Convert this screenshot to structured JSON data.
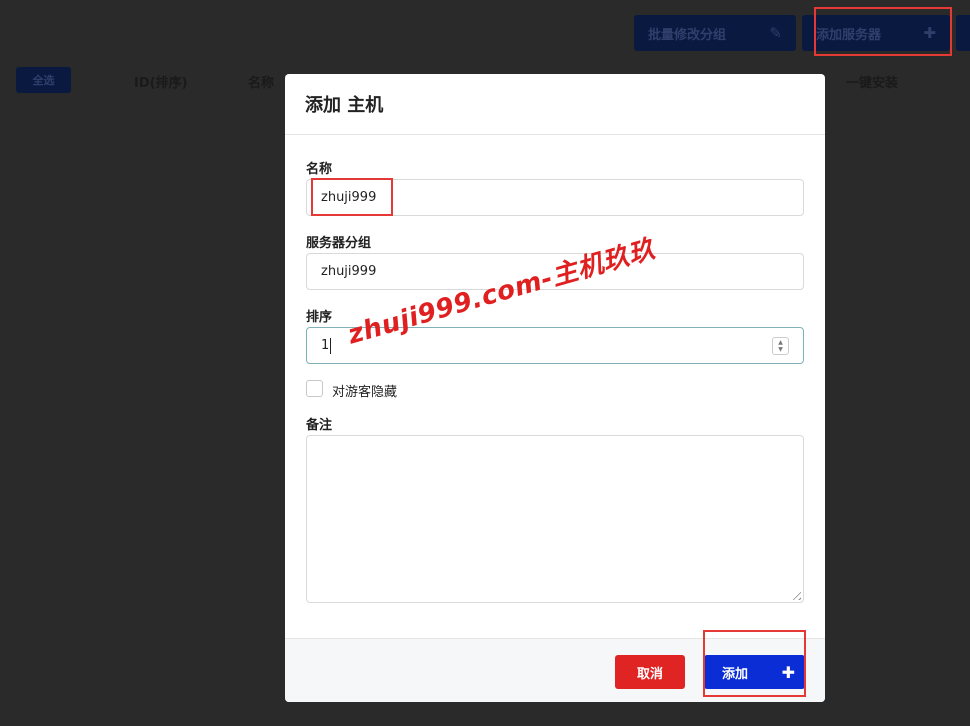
{
  "toolbar": {
    "batch_label": "批量修改分组",
    "add_server_label": "添加服务器"
  },
  "table": {
    "select_all": "全选",
    "headers": [
      "ID(排序)",
      "名称",
      "一键安装"
    ]
  },
  "modal": {
    "title": "添加 主机",
    "name_label": "名称",
    "name_value": "zhuji999",
    "group_label": "服务器分组",
    "group_value": "zhuji999",
    "sort_label": "排序",
    "sort_value": "1",
    "hide_label": "对游客隐藏",
    "note_label": "备注",
    "note_value": "",
    "cancel_label": "取消",
    "submit_label": "添加"
  },
  "watermark": "zhuji999.com-主机玖玖",
  "colors": {
    "primary": "#0a2dd6",
    "danger": "#e02424",
    "highlight": "#e53935"
  }
}
